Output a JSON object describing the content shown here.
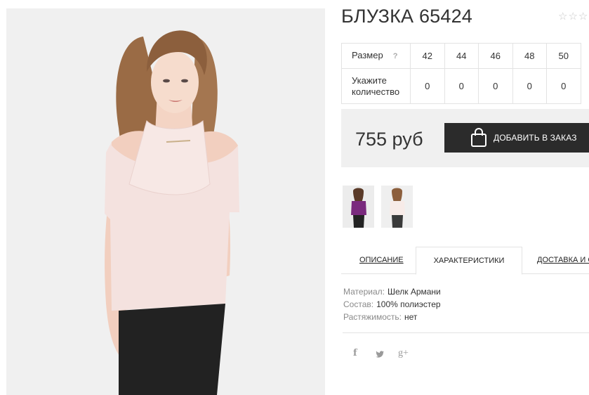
{
  "product": {
    "title": "БЛУЗКА 65424",
    "rating_stars": "☆☆☆"
  },
  "sizes": {
    "size_label": "Размер",
    "help_mark": "?",
    "qty_label_line1": "Укажите",
    "qty_label_line2": "количество",
    "values": [
      "42",
      "44",
      "46",
      "48",
      "50"
    ],
    "quantities": [
      "0",
      "0",
      "0",
      "0",
      "0"
    ]
  },
  "purchase": {
    "price": "755 руб",
    "add_button_label": "ДОБАВИТЬ В ЗАКАЗ"
  },
  "tabs": [
    {
      "label": "ОПИСАНИЕ"
    },
    {
      "label": "ХАРАКТЕРИСТИКИ"
    },
    {
      "label": "ДОСТАВКА И С"
    }
  ],
  "specs": [
    {
      "key": "Материал:",
      "value": "Шелк Армани"
    },
    {
      "key": "Состав:",
      "value": "100% полиэстер"
    },
    {
      "key": "Растяжимость:",
      "value": "нет"
    }
  ],
  "social": {
    "facebook": "f",
    "googleplus": "g+"
  },
  "colors": {
    "button_bg": "#2b2b2b",
    "price_box_bg": "#f0f0f0",
    "blouse": "#f4e2df",
    "thumb_blouse_alt": "#7a2a7e"
  }
}
